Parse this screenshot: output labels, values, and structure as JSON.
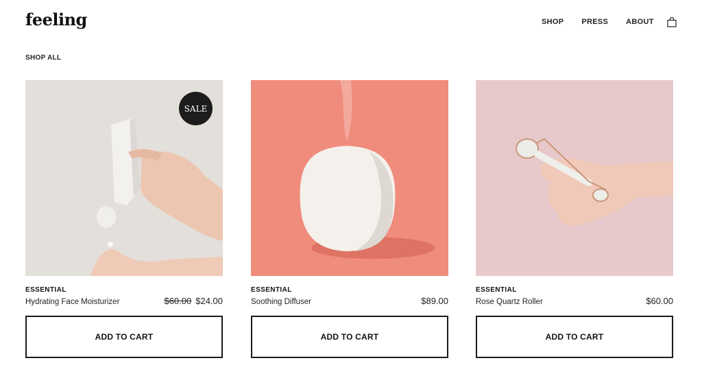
{
  "brand": {
    "logo": "feeling"
  },
  "nav": {
    "items": [
      "SHOP",
      "PRESS",
      "ABOUT"
    ],
    "bag_icon": "shopping-bag-icon"
  },
  "breadcrumb": "SHOP ALL",
  "products": [
    {
      "category": "ESSENTIAL",
      "name": "Hydrating Face Moisturizer",
      "old_price": "$60.00",
      "price": "$24.00",
      "badge": "SALE",
      "button": "ADD TO CART",
      "image_bg": "#e3dfdb"
    },
    {
      "category": "ESSENTIAL",
      "name": "Soothing Diffuser",
      "price": "$89.00",
      "button": "ADD TO CART",
      "image_bg": "#f08c7c"
    },
    {
      "category": "ESSENTIAL",
      "name": "Rose Quartz Roller",
      "price": "$60.00",
      "button": "ADD TO CART",
      "image_bg": "#e8c9cb"
    }
  ]
}
